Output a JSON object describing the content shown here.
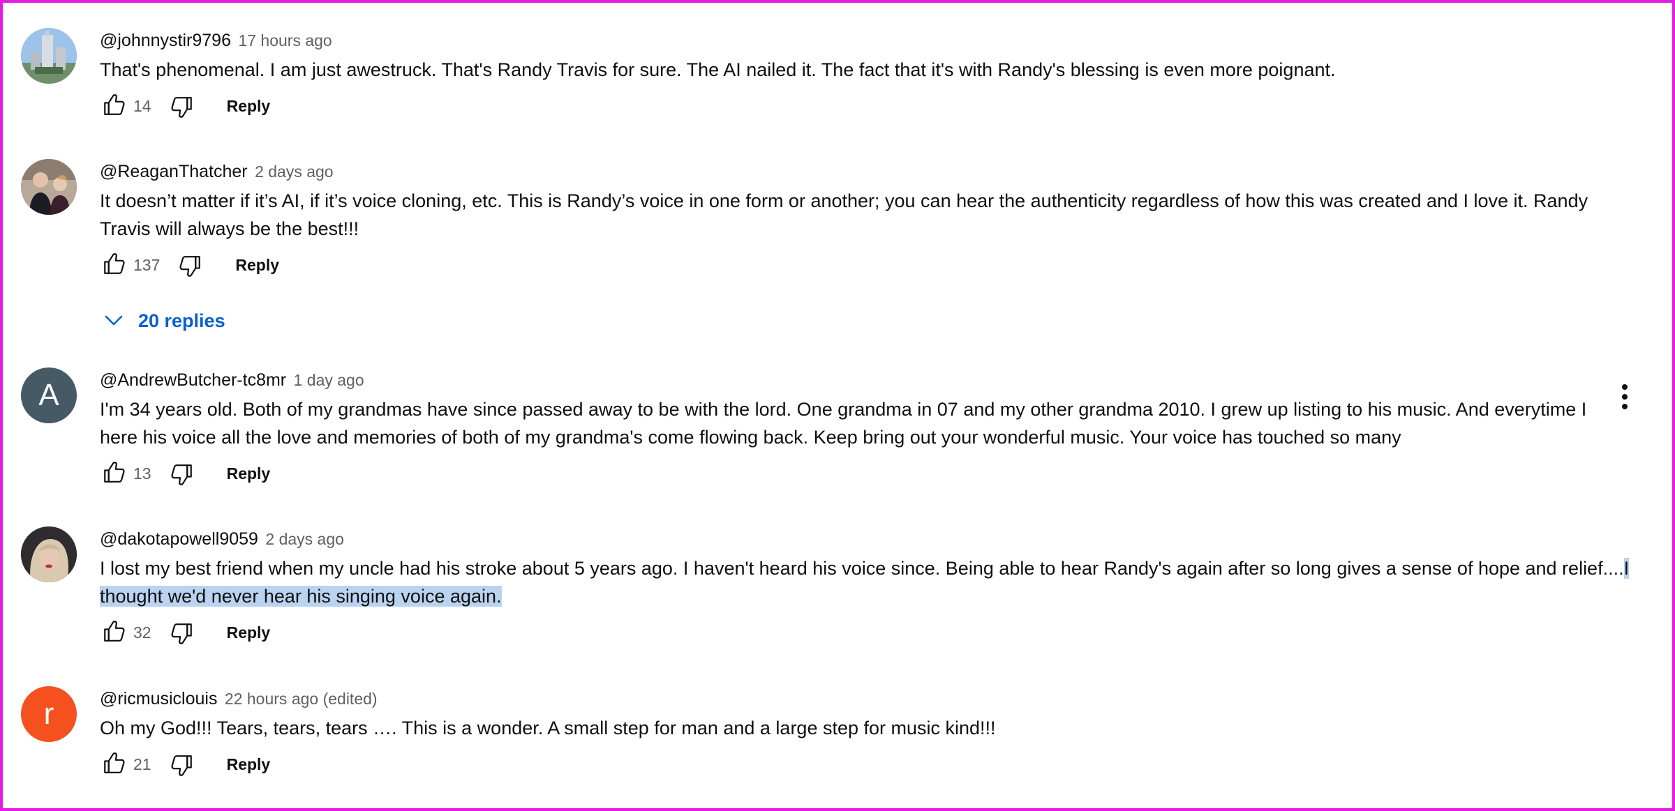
{
  "comments": [
    {
      "author": "@johnnystir9796",
      "time": "17 hours ago",
      "text": "That's phenomenal. I am just awestruck. That's Randy Travis for sure. The AI nailed it. The fact that it's with Randy's blessing is even more poignant.",
      "likes": "14",
      "reply_label": "Reply",
      "avatar_icon": "building-photo"
    },
    {
      "author": "@ReaganThatcher",
      "time": "2 days ago",
      "text": "It doesn’t matter if it’s AI, if it’s voice cloning, etc. This is Randy’s voice in one form or another; you can hear the authenticity regardless of how this was created and I love it. Randy Travis will always be the best!!!",
      "likes": "137",
      "reply_label": "Reply",
      "replies_label": "20 replies",
      "avatar_icon": "two-people-photo"
    },
    {
      "author": "@AndrewButcher-tc8mr",
      "time": "1 day ago",
      "text": "I'm 34 years old. Both of my grandmas have since passed away to be with the lord. One grandma in 07 and my other grandma 2010.  I grew up listing to his music. And everytime I here his voice all the love and memories of both of my grandma's come flowing back.  Keep bring out your wonderful music. Your voice has touched so many",
      "likes": "13",
      "reply_label": "Reply",
      "avatar_letter": "A",
      "avatar_color": "#455a64"
    },
    {
      "author": "@dakotapowell9059",
      "time": "2 days ago",
      "text_plain": "I lost my best friend when my uncle had his stroke about 5 years ago. I haven't heard his voice since. Being able to hear Randy's again after so long gives a sense of hope and relief....",
      "text_selected": "I thought we'd never hear his singing voice again.",
      "likes": "32",
      "reply_label": "Reply",
      "avatar_icon": "woman-photo"
    },
    {
      "author": "@ricmusiclouis",
      "time": "22 hours ago (edited)",
      "text": "Oh my God!!! Tears, tears, tears …. This is a wonder.   A small step for man and a large step for music kind!!!",
      "likes": "21",
      "reply_label": "Reply",
      "avatar_letter": "r",
      "avatar_color": "#f4511e"
    }
  ],
  "icons": {
    "like": "thumbs-up-icon",
    "dislike": "thumbs-down-icon",
    "expand": "chevron-down-icon",
    "more": "vertical-dots-icon"
  },
  "colors": {
    "frame": "#e41ee0",
    "link": "#065fd4",
    "selection": "#b9d3f0"
  }
}
